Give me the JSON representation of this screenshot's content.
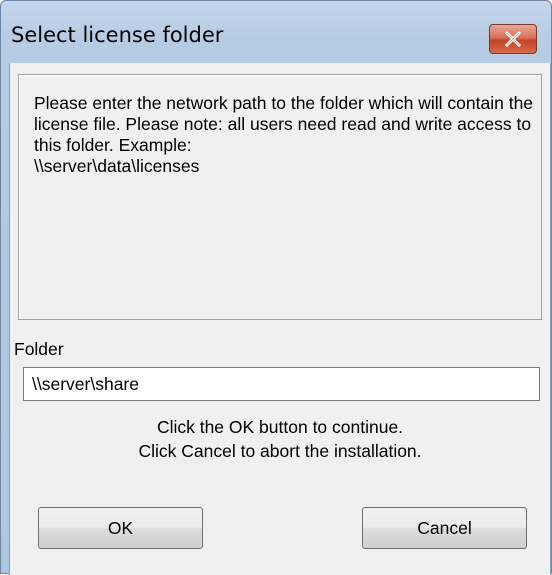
{
  "dialog": {
    "title": "Select license folder",
    "info_text": "Please enter the network path to the folder which will contain the license file. Please note: all users need read and write access to this folder. Example:\n\\\\server\\data\\licenses",
    "folder_label": "Folder",
    "folder_value": "\\\\server\\share",
    "hint_line1": "Click the OK button to continue.",
    "hint_line2": "Click Cancel to abort the installation.",
    "ok_label": "OK",
    "cancel_label": "Cancel"
  },
  "icons": {
    "close": "close-icon"
  },
  "colors": {
    "titlebar": "#b9cde5",
    "close_button": "#c94b33",
    "client_bg": "#f0f0f0"
  }
}
